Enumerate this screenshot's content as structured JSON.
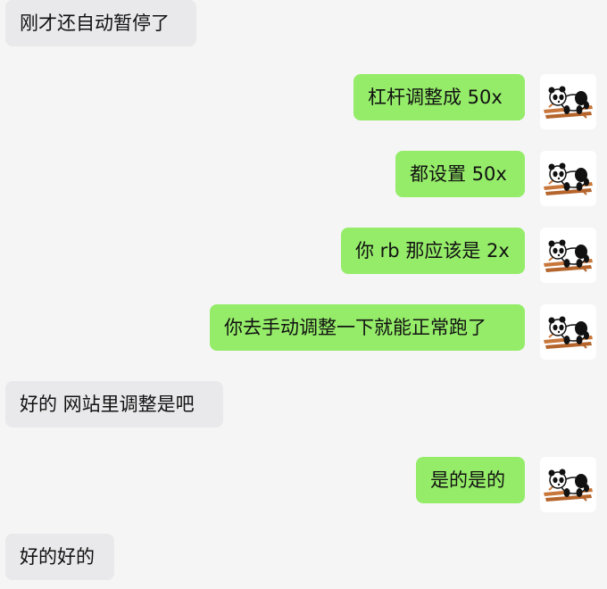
{
  "messages": [
    {
      "from": "other",
      "text": "刚才还自动暂停了"
    },
    {
      "from": "self",
      "text": "杠杆调整成 50x",
      "avatar": "panda-avatar-icon"
    },
    {
      "from": "self",
      "text": "都设置 50x",
      "avatar": "panda-avatar-icon"
    },
    {
      "from": "self",
      "text": "你 rb 那应该是 2x",
      "avatar": "panda-avatar-icon"
    },
    {
      "from": "self",
      "text": "你去手动调整一下就能正常跑了",
      "avatar": "panda-avatar-icon"
    },
    {
      "from": "other",
      "text": "好的 网站里调整是吧"
    },
    {
      "from": "self",
      "text": "是的是的",
      "avatar": "panda-avatar-icon"
    },
    {
      "from": "other",
      "text": "好的好的"
    }
  ],
  "colors": {
    "background": "#f5f5f5",
    "incoming_bubble": "#e9e9eb",
    "outgoing_bubble": "#95ec69",
    "avatar_bg": "#ffffff"
  }
}
